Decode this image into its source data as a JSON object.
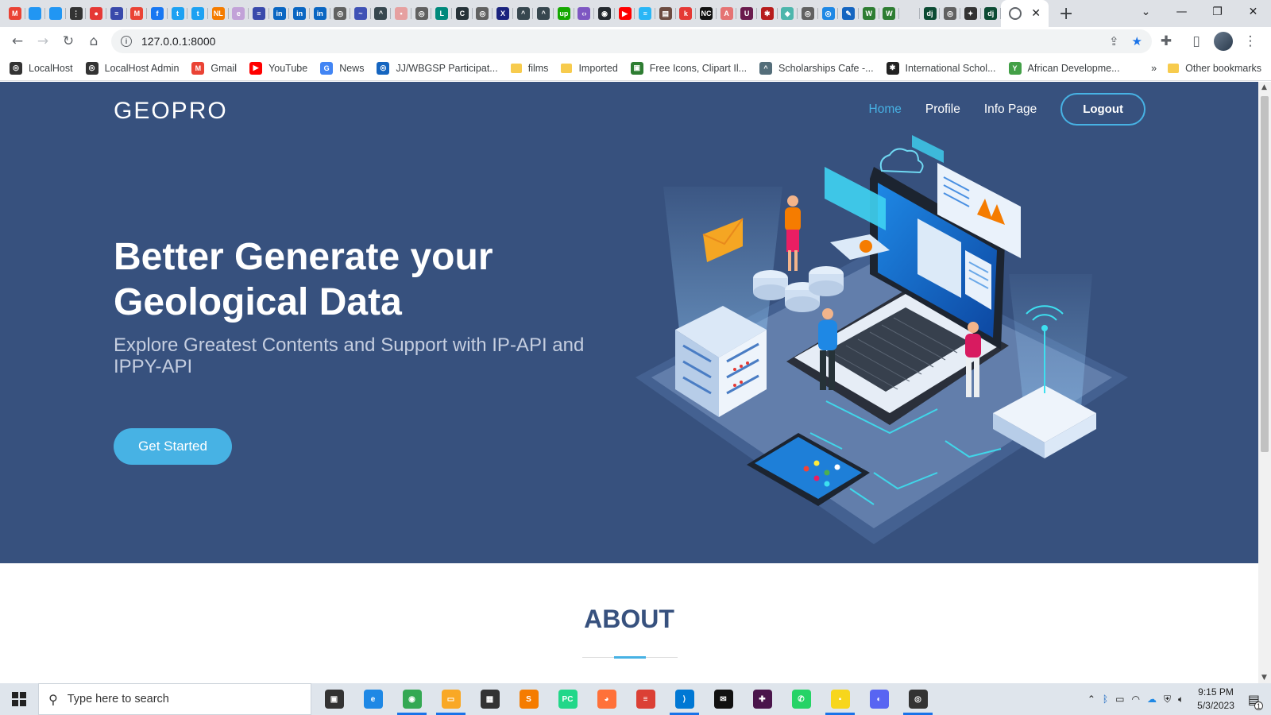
{
  "browser": {
    "tab_favicons": [
      {
        "icon": "gmail-icon",
        "color": "#ea4335",
        "glyph": "M"
      },
      {
        "icon": "page-icon",
        "color": "#2196f3",
        "glyph": ""
      },
      {
        "icon": "page-icon",
        "color": "#2196f3",
        "glyph": ""
      },
      {
        "icon": "dots-icon",
        "color": "#333333",
        "glyph": "⋮"
      },
      {
        "icon": "red-icon",
        "color": "#e53935",
        "glyph": "●"
      },
      {
        "icon": "bookmark-icon",
        "color": "#3949ab",
        "glyph": "≡"
      },
      {
        "icon": "gmail-icon",
        "color": "#ea4335",
        "glyph": "M"
      },
      {
        "icon": "facebook-icon",
        "color": "#1877f2",
        "glyph": "f"
      },
      {
        "icon": "twitter-icon",
        "color": "#1da1f2",
        "glyph": "t"
      },
      {
        "icon": "twitter-icon",
        "color": "#1da1f2",
        "glyph": "t"
      },
      {
        "icon": "orange-icon",
        "color": "#f57c00",
        "glyph": "NL"
      },
      {
        "icon": "pink-icon",
        "color": "#c2a2d8",
        "glyph": "e"
      },
      {
        "icon": "bookmark-icon",
        "color": "#3949ab",
        "glyph": "≡"
      },
      {
        "icon": "linkedin-icon",
        "color": "#0a66c2",
        "glyph": "in"
      },
      {
        "icon": "linkedin-icon",
        "color": "#0a66c2",
        "glyph": "in"
      },
      {
        "icon": "linkedin-icon",
        "color": "#0a66c2",
        "glyph": "in"
      },
      {
        "icon": "globe-icon",
        "color": "#616161",
        "glyph": "◎"
      },
      {
        "icon": "site-icon",
        "color": "#3f51b5",
        "glyph": "~"
      },
      {
        "icon": "graduation-icon",
        "color": "#37474f",
        "glyph": "^"
      },
      {
        "icon": "person-icon",
        "color": "#e6a0a0",
        "glyph": "•"
      },
      {
        "icon": "globe-icon",
        "color": "#616161",
        "glyph": "◎"
      },
      {
        "icon": "chart-icon",
        "color": "#00897b",
        "glyph": "L"
      },
      {
        "icon": "c-icon",
        "color": "#263238",
        "glyph": "C"
      },
      {
        "icon": "globe-icon",
        "color": "#616161",
        "glyph": "◎"
      },
      {
        "icon": "shield-icon",
        "color": "#1a237e",
        "glyph": "X"
      },
      {
        "icon": "graduation-icon",
        "color": "#37474f",
        "glyph": "^"
      },
      {
        "icon": "graduation-icon",
        "color": "#37474f",
        "glyph": "^"
      },
      {
        "icon": "upwork-icon",
        "color": "#14a800",
        "glyph": "up"
      },
      {
        "icon": "code-icon",
        "color": "#7e57c2",
        "glyph": "‹›"
      },
      {
        "icon": "github-icon",
        "color": "#24292f",
        "glyph": "◉"
      },
      {
        "icon": "youtube-icon",
        "color": "#ff0000",
        "glyph": "▶"
      },
      {
        "icon": "chat-icon",
        "color": "#29b6f6",
        "glyph": "≡"
      },
      {
        "icon": "image-icon",
        "color": "#6d4c41",
        "glyph": "▤"
      },
      {
        "icon": "k-icon",
        "color": "#e53935",
        "glyph": "k"
      },
      {
        "icon": "nc-icon",
        "color": "#111111",
        "glyph": "NC"
      },
      {
        "icon": "a-icon",
        "color": "#e57373",
        "glyph": "A"
      },
      {
        "icon": "u-icon",
        "color": "#6a1b4d",
        "glyph": "U"
      },
      {
        "icon": "dots-icon",
        "color": "#b71c1c",
        "glyph": "✱"
      },
      {
        "icon": "cube-icon",
        "color": "#4db6ac",
        "glyph": "◆"
      },
      {
        "icon": "globe-icon",
        "color": "#616161",
        "glyph": "◎"
      },
      {
        "icon": "globe-icon",
        "color": "#1e88e5",
        "glyph": "◎"
      },
      {
        "icon": "pen-icon",
        "color": "#1565c0",
        "glyph": "✎"
      },
      {
        "icon": "w-icon",
        "color": "#2e7d32",
        "glyph": "W"
      },
      {
        "icon": "w-icon",
        "color": "#2e7d32",
        "glyph": "W"
      },
      {
        "icon": "blank-icon",
        "color": "#dee1e6",
        "glyph": ""
      },
      {
        "icon": "django-icon",
        "color": "#0c4b33",
        "glyph": "dj"
      },
      {
        "icon": "globe-icon",
        "color": "#616161",
        "glyph": "◎"
      },
      {
        "icon": "puzzle-icon",
        "color": "#333333",
        "glyph": "✦"
      },
      {
        "icon": "django-icon",
        "color": "#0c4b33",
        "glyph": "dj"
      }
    ],
    "address_url": "127.0.0.1:8000",
    "bookmarks": [
      {
        "label": "LocalHost",
        "icon": "globe-icon",
        "color": "#333333",
        "glyph": "◎"
      },
      {
        "label": "LocalHost Admin",
        "icon": "globe-icon",
        "color": "#333333",
        "glyph": "◎"
      },
      {
        "label": "Gmail",
        "icon": "gmail-icon",
        "color": "#ea4335",
        "glyph": "M"
      },
      {
        "label": "YouTube",
        "icon": "youtube-icon",
        "color": "#ff0000",
        "glyph": "▶"
      },
      {
        "label": "News",
        "icon": "news-icon",
        "color": "#4285f4",
        "glyph": "G"
      },
      {
        "label": "JJ/WBGSP Participat...",
        "icon": "globe-icon",
        "color": "#1565c0",
        "glyph": "◎"
      },
      {
        "label": "films",
        "icon": "folder-icon",
        "color": "#f7cb4d",
        "glyph": ""
      },
      {
        "label": "Imported",
        "icon": "folder-icon",
        "color": "#f7cb4d",
        "glyph": ""
      },
      {
        "label": "Free Icons, Clipart Il...",
        "icon": "icons-icon",
        "color": "#2e7d32",
        "glyph": "▣"
      },
      {
        "label": "Scholarships Cafe -...",
        "icon": "graduation-icon",
        "color": "#546e7a",
        "glyph": "^"
      },
      {
        "label": "International Schol...",
        "icon": "paw-icon",
        "color": "#222222",
        "glyph": "✱"
      },
      {
        "label": "African Developme...",
        "icon": "afdb-icon",
        "color": "#43a047",
        "glyph": "Y"
      }
    ],
    "other_bookmarks": "Other bookmarks"
  },
  "site": {
    "logo": "GEOPRO",
    "nav": [
      {
        "label": "Home",
        "active": true
      },
      {
        "label": "Profile",
        "active": false
      },
      {
        "label": "Info Page",
        "active": false
      }
    ],
    "logout": "Logout",
    "headline": "Better Generate your Geological Data",
    "subheadline": "Explore Greatest Contents and Support with IP-API and IPPY-API",
    "cta": "Get Started",
    "about_title": "ABOUT",
    "colors": {
      "hero_bg": "#37517e",
      "accent": "#47b2e4"
    }
  },
  "taskbar": {
    "search_placeholder": "Type here to search",
    "apps": [
      {
        "icon": "task-view-icon",
        "color": "#333333",
        "glyph": "▣",
        "running": false
      },
      {
        "icon": "edge-icon",
        "color": "#1e88e5",
        "glyph": "e",
        "running": false
      },
      {
        "icon": "chrome-icon",
        "color": "#34a853",
        "glyph": "◉",
        "running": true
      },
      {
        "icon": "file-explorer-icon",
        "color": "#f9a825",
        "glyph": "▭",
        "running": true
      },
      {
        "icon": "store-icon",
        "color": "#333333",
        "glyph": "▦",
        "running": false
      },
      {
        "icon": "sublime-icon",
        "color": "#f57c00",
        "glyph": "S",
        "running": false
      },
      {
        "icon": "pycharm-icon",
        "color": "#21d789",
        "glyph": "PC",
        "running": false
      },
      {
        "icon": "firefox-icon",
        "color": "#ff7139",
        "glyph": "◕",
        "running": false
      },
      {
        "icon": "todoist-icon",
        "color": "#db4035",
        "glyph": "≡",
        "running": false
      },
      {
        "icon": "vscode-icon",
        "color": "#0078d4",
        "glyph": "⟩",
        "running": true
      },
      {
        "icon": "mail-icon",
        "color": "#111111",
        "glyph": "✉",
        "running": false
      },
      {
        "icon": "slack-icon",
        "color": "#4a154b",
        "glyph": "✚",
        "running": false
      },
      {
        "icon": "whatsapp-icon",
        "color": "#25d366",
        "glyph": "✆",
        "running": false
      },
      {
        "icon": "sticky-notes-icon",
        "color": "#f7d61c",
        "glyph": "▪",
        "running": true
      },
      {
        "icon": "discord-icon",
        "color": "#5865f2",
        "glyph": "◐",
        "running": false
      },
      {
        "icon": "obs-icon",
        "color": "#333333",
        "glyph": "◎",
        "running": true
      }
    ],
    "time": "9:15 PM",
    "date": "5/3/2023",
    "notification_count": "1"
  }
}
